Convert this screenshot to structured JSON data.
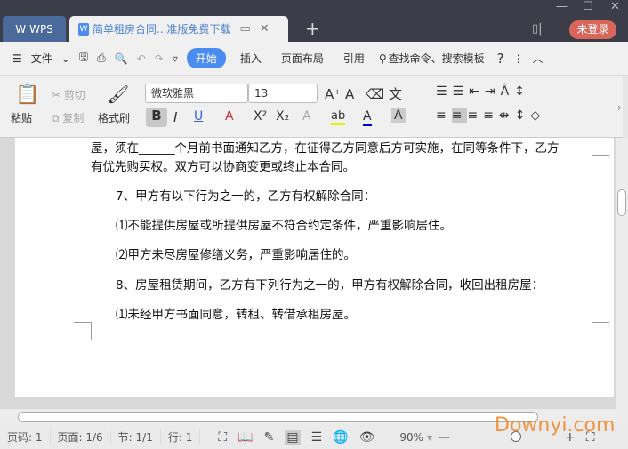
{
  "titlebar": {
    "app_tab": "WPS",
    "doc_tab": "简单租房合同...准版免费下载",
    "new_tab": "+",
    "login": "未登录"
  },
  "menubar": {
    "file": "文件",
    "tabs": [
      "开始",
      "插入",
      "页面布局",
      "引用"
    ],
    "search": "查找命令、搜索模板",
    "help": "?"
  },
  "ribbon": {
    "paste": "粘贴",
    "cut": "剪切",
    "copy": "复制",
    "format_painter": "格式刷",
    "font": "微软雅黑",
    "size": "13"
  },
  "document": {
    "lines": [
      "屋，须在______个月前书面通知乙方，在征得乙方同意后方可实施，在同等条件下，乙方",
      "有优先购买权。双方可以协商变更或终止本合同。",
      "7、甲方有以下行为之一的，乙方有权解除合同：",
      "⑴不能提供房屋或所提供房屋不符合约定条件，严重影响居住。",
      "⑵甲方未尽房屋修缮义务，严重影响居住的。",
      "8、房屋租赁期间，乙方有下列行为之一的，甲方有权解除合同，收回出租房屋：",
      "⑴未经甲方书面同意，转租、转借承租房屋。"
    ]
  },
  "status": {
    "page_num": "页码: 1",
    "pages": "页面: 1/6",
    "section": "节: 1/1",
    "line": "行: 1",
    "zoom": "90%",
    "zoom_level_percent": 90
  },
  "watermark": "Downyi.com",
  "colors": {
    "accent": "#4a8cf0",
    "login": "#d9665a",
    "titlebar": "#3b3e48"
  }
}
